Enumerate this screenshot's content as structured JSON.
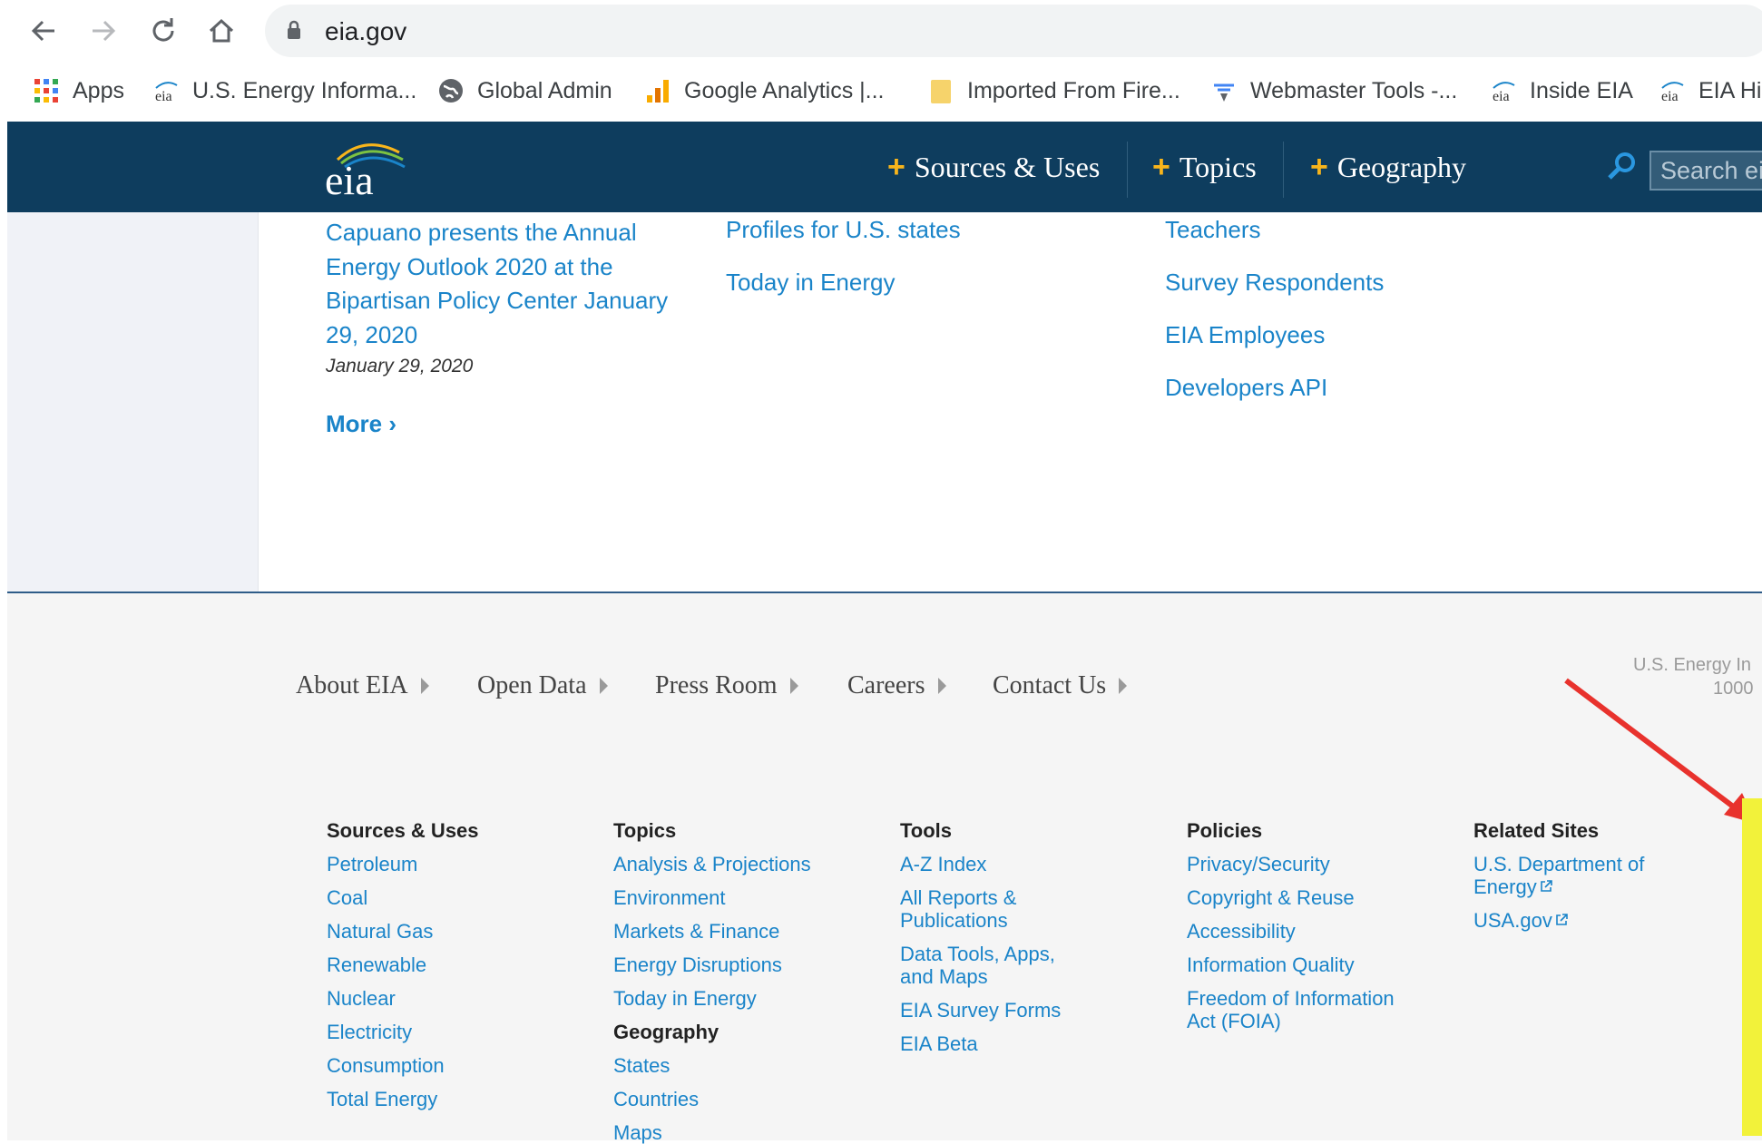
{
  "browser": {
    "url": "eia.gov",
    "bookmarks": [
      {
        "label": "Apps",
        "icon": "apps-grid-icon"
      },
      {
        "label": "U.S. Energy Informa...",
        "icon": "eia-favicon-icon"
      },
      {
        "label": "Global Admin",
        "icon": "globe-icon"
      },
      {
        "label": "Google Analytics |...",
        "icon": "analytics-icon"
      },
      {
        "label": "Imported From Fire...",
        "icon": "folder-icon"
      },
      {
        "label": "Webmaster Tools -...",
        "icon": "webmaster-icon"
      },
      {
        "label": "Inside EIA",
        "icon": "eia-favicon-icon"
      },
      {
        "label": "EIA Hi",
        "icon": "eia-favicon-icon"
      }
    ]
  },
  "header": {
    "logo_text": "eia",
    "nav": [
      {
        "label": "Sources & Uses"
      },
      {
        "label": "Topics"
      },
      {
        "label": "Geography"
      }
    ],
    "search_placeholder": "Search eia"
  },
  "content": {
    "news_title": "Capuano presents the Annual Energy Outlook 2020 at the Bipartisan Policy Center January 29, 2020",
    "news_date": "January 29, 2020",
    "more_label": "More ›",
    "middle_links": [
      "Profiles for U.S. states",
      "Today in Energy"
    ],
    "right_links": [
      "Teachers",
      "Survey Respondents",
      "EIA Employees",
      "Developers API"
    ]
  },
  "footer": {
    "nav": [
      "About EIA",
      "Open Data",
      "Press Room",
      "Careers",
      "Contact Us"
    ],
    "address_line1": "U.S. Energy In",
    "address_line2": "1000",
    "columns": {
      "sources": {
        "heading": "Sources & Uses",
        "links": [
          "Petroleum",
          "Coal",
          "Natural Gas",
          "Renewable",
          "Nuclear",
          "Electricity",
          "Consumption",
          "Total Energy"
        ]
      },
      "topics": {
        "heading": "Topics",
        "links": [
          "Analysis & Projections",
          "Environment",
          "Markets & Finance",
          "Energy Disruptions",
          "Today in Energy"
        ],
        "subheading": "Geography",
        "sub_links": [
          "States",
          "Countries",
          "Maps"
        ]
      },
      "tools": {
        "heading": "Tools",
        "links": [
          "A-Z Index",
          "All Reports & Publications",
          "Data Tools, Apps, and Maps",
          "EIA Survey Forms",
          "EIA Beta"
        ]
      },
      "policies": {
        "heading": "Policies",
        "links": [
          "Privacy/Security",
          "Copyright & Reuse",
          "Accessibility",
          "Information Quality",
          "Freedom of Information Act (FOIA)"
        ]
      },
      "related": {
        "heading": "Related Sites",
        "links": [
          "U.S. Department of Energy",
          "USA.gov"
        ]
      }
    }
  },
  "colors": {
    "header_bg": "#0e3d5e",
    "link": "#1a84c9",
    "plus_accent": "#f8b51b",
    "annotation_arrow": "#e8322d",
    "annotation_highlight": "#f2f23a"
  }
}
